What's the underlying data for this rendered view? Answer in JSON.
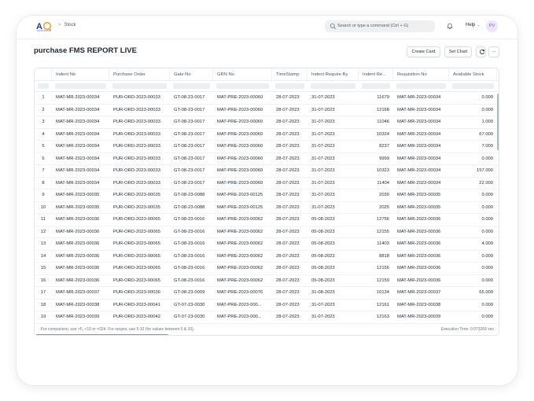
{
  "navbar": {
    "breadcrumb": "Stock",
    "search_placeholder": "Search or type a command (Ctrl + G)",
    "help_label": "Help",
    "avatar_initials": "PV"
  },
  "page": {
    "title": "purchase FMS REPORT LIVE",
    "create_card_label": "Create Card",
    "set_chart_label": "Set Chart",
    "more_label": "···"
  },
  "columns": [
    "Indent No",
    "Purchase Order",
    "Gate No",
    "GRN No",
    "TimeStamp",
    "Indent Require By",
    "Indent Re...",
    "Requisition No",
    "Available Stock"
  ],
  "rows": [
    [
      "1",
      "MAT-MR-2023-00034",
      "PUR-ORD-2023-00033",
      "GT-08-23-0017",
      "MAT-PRE-2023-00060",
      "28-07-2023",
      "31-07-2023",
      "11679",
      "MAT-MR-2023-00034",
      "0.000"
    ],
    [
      "2",
      "MAT-MR-2023-00034",
      "PUR-ORD-2023-00033",
      "GT-08-23-0017",
      "MAT-PRE-2023-00060",
      "28-07-2023",
      "31-07-2023",
      "12168",
      "MAT-MR-2023-00034",
      "0.000"
    ],
    [
      "3",
      "MAT-MR-2023-00034",
      "PUR-ORD-2023-00033",
      "GT-08-23-0017",
      "MAT-PRE-2023-00060",
      "28-07-2023",
      "31-07-2023",
      "11046",
      "MAT-MR-2023-00034",
      "1.000"
    ],
    [
      "4",
      "MAT-MR-2023-00034",
      "PUR-ORD-2023-00033",
      "GT-08-23-0017",
      "MAT-PRE-2023-00060",
      "28-07-2023",
      "31-07-2023",
      "10324",
      "MAT-MR-2023-00034",
      "67.000"
    ],
    [
      "5",
      "MAT-MR-2023-00034",
      "PUR-ORD-2023-00033",
      "GT-08-23-0017",
      "MAT-PRE-2023-00060",
      "28-07-2023",
      "31-07-2023",
      "8237",
      "MAT-MR-2023-00034",
      "7.000"
    ],
    [
      "6",
      "MAT-MR-2023-00034",
      "PUR-ORD-2023-00033",
      "GT-08-23-0017",
      "MAT-PRE-2023-00060",
      "28-07-2023",
      "31-07-2023",
      "9999",
      "MAT-MR-2023-00034",
      "0.000"
    ],
    [
      "7",
      "MAT-MR-2023-00034",
      "PUR-ORD-2023-00033",
      "GT-08-23-0017",
      "MAT-PRE-2023-00060",
      "28-07-2023",
      "31-07-2023",
      "10323",
      "MAT-MR-2023-00034",
      "157.000"
    ],
    [
      "8",
      "MAT-MR-2023-00034",
      "PUR-ORD-2023-00033",
      "GT-08-23-0017",
      "MAT-PRE-2023-00060",
      "28-07-2023",
      "31-07-2023",
      "11404",
      "MAT-MR-2023-00034",
      "22.000"
    ],
    [
      "9",
      "MAT-MR-2023-00035",
      "PUR-ORD-2023-00035",
      "GT-08-23-0088",
      "MAT-PRE-2023-00125",
      "28-07-2023",
      "31-07-2023",
      "2030",
      "MAT-MR-2023-00035",
      "0.000"
    ],
    [
      "10",
      "MAT-MR-2023-00035",
      "PUR-ORD-2023-00035",
      "GT-08-23-0088",
      "MAT-PRE-2023-00125",
      "28-07-2023",
      "31-07-2023",
      "2025",
      "MAT-MR-2023-00035",
      "0.000"
    ],
    [
      "11",
      "MAT-MR-2023-00036",
      "PUR-ORD-2023-00065",
      "GT-08-23-0016",
      "MAT-PRE-2023-00062",
      "28-07-2023",
      "05-08-2023",
      "12756",
      "MAT-MR-2023-00036",
      "0.000"
    ],
    [
      "12",
      "MAT-MR-2023-00036",
      "PUR-ORD-2023-00065",
      "GT-08-23-0016",
      "MAT-PRE-2023-00062",
      "28-07-2023",
      "05-08-2023",
      "12155",
      "MAT-MR-2023-00036",
      "0.000"
    ],
    [
      "13",
      "MAT-MR-2023-00036",
      "PUR-ORD-2023-00065",
      "GT-08-23-0016",
      "MAT-PRE-2023-00062",
      "28-07-2023",
      "05-08-2023",
      "11403",
      "MAT-MR-2023-00036",
      "4.000"
    ],
    [
      "14",
      "MAT-MR-2023-00036",
      "PUR-ORD-2023-00065",
      "GT-08-23-0016",
      "MAT-PRE-2023-00062",
      "28-07-2023",
      "05-08-2023",
      "8818",
      "MAT-MR-2023-00036",
      "0.000"
    ],
    [
      "15",
      "MAT-MR-2023-00036",
      "PUR-ORD-2023-00065",
      "GT-08-23-0016",
      "MAT-PRE-2023-00062",
      "28-07-2023",
      "05-08-2023",
      "12156",
      "MAT-MR-2023-00036",
      "0.000"
    ],
    [
      "16",
      "MAT-MR-2023-00036",
      "PUR-ORD-2023-00065",
      "GT-08-23-0016",
      "MAT-PRE-2023-00062",
      "28-07-2023",
      "05-08-2023",
      "12159",
      "MAT-MR-2023-00036",
      "0.000"
    ],
    [
      "17",
      "MAT-MR-2023-00037",
      "PUR-ORD-2023-00036",
      "GT-08-23-0009",
      "MAT-PRE-2023-00076",
      "28-07-2023",
      "31-08-2023",
      "10134",
      "MAT-MR-2023-00037",
      "65.000"
    ],
    [
      "18",
      "MAT-MR-2023-00038",
      "PUR-ORD-2023-00041",
      "GT-07-23-0030",
      "MAT-PRE-2023-000...",
      "28-07-2023",
      "31-07-2023",
      "12161",
      "MAT-MR-2023-00038",
      "0.000"
    ],
    [
      "19",
      "MAT-MR-2023-00039",
      "PUR-ORD-2023-00042",
      "GT-07-23-0030",
      "MAT-PRE-2023-000...",
      "28-07-2023",
      "31-07-2023",
      "12163",
      "MAT-MR-2023-00039",
      "0.000"
    ]
  ],
  "footer": {
    "note": "For comparison, use >5, <10 or =324. For ranges, use 5:10 (for values between 5 & 10).",
    "execution_time": "Execution Time: 0.073269 sec"
  }
}
